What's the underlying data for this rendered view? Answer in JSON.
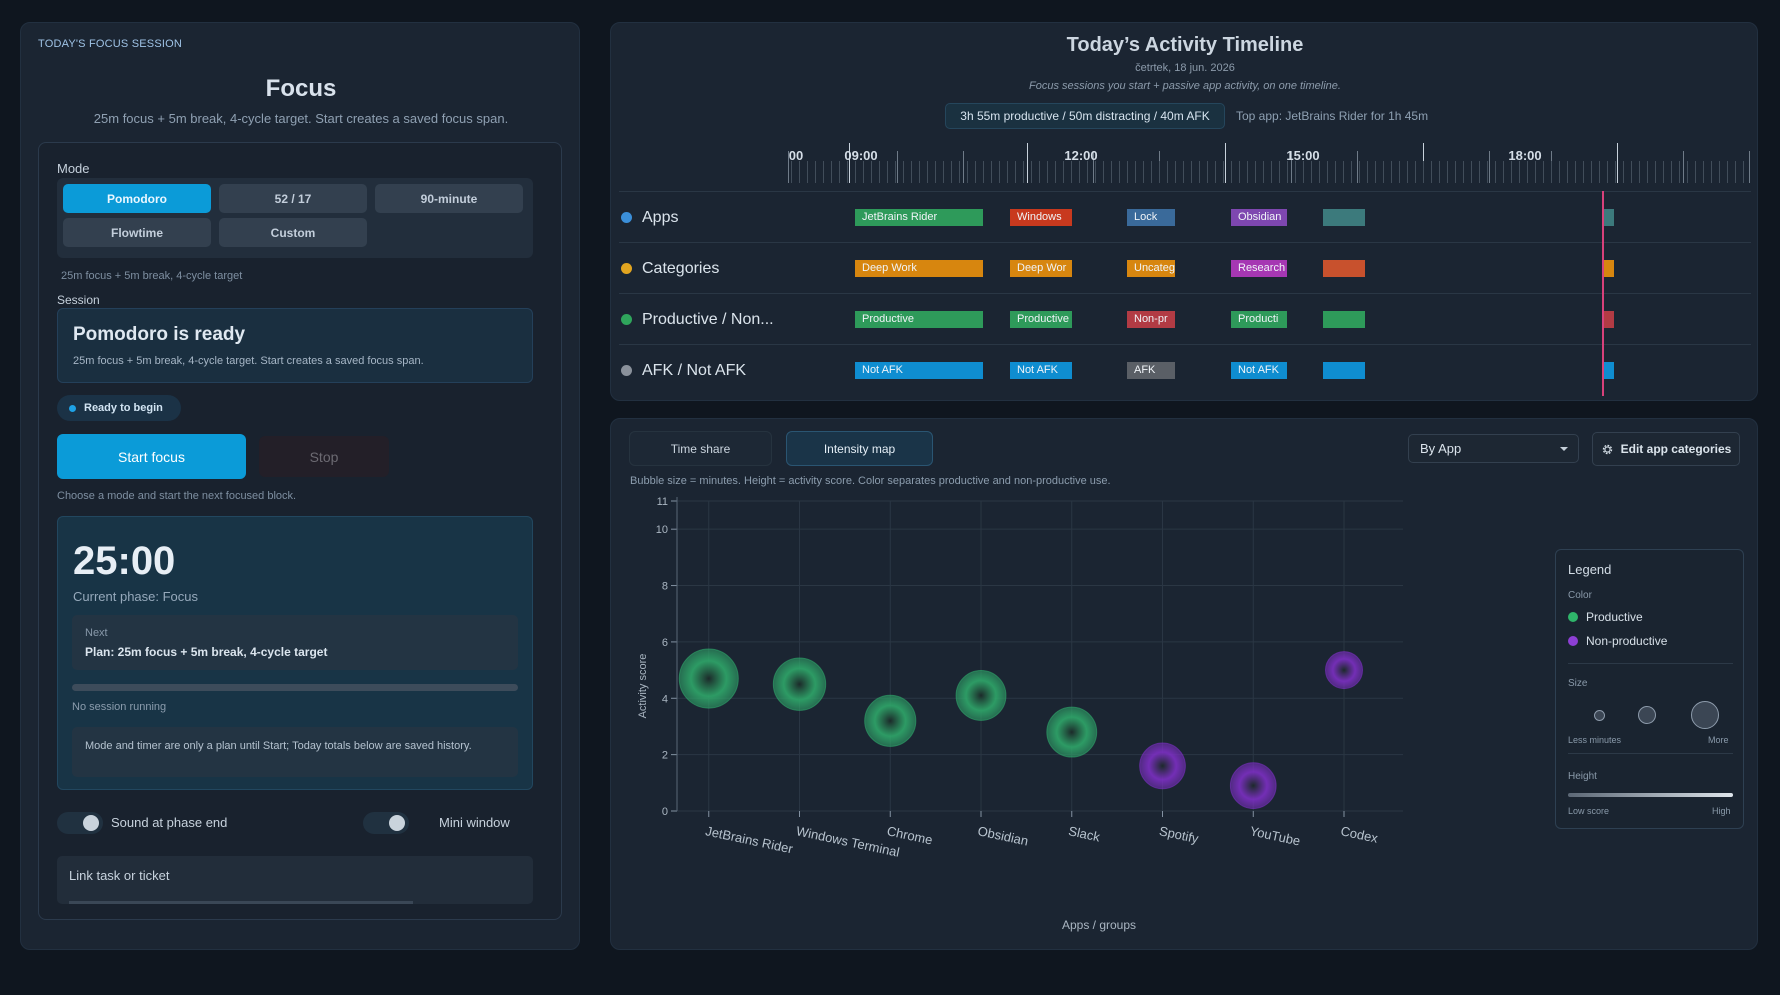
{
  "focus": {
    "eyebrow": "TODAY'S FOCUS SESSION",
    "title": "Focus",
    "subtitle": "25m focus + 5m break, 4-cycle target. Start creates a saved focus span.",
    "mode_label": "Mode",
    "modes": [
      "Pomodoro",
      "52 / 17",
      "90-minute",
      "Flowtime",
      "Custom"
    ],
    "active_mode": "Pomodoro",
    "mode_note": "25m focus + 5m break, 4-cycle target",
    "session_label": "Session",
    "session_title": "Pomodoro is ready",
    "session_desc": "25m focus + 5m break, 4-cycle target. Start creates a saved focus span.",
    "status_pill": "Ready to begin",
    "start_label": "Start focus",
    "stop_label": "Stop",
    "hint": "Choose a mode and start the next focused block.",
    "timer": "25:00",
    "phase": "Current phase: Focus",
    "next_label": "Next",
    "next_text": "Plan: 25m focus + 5m break, 4-cycle target",
    "progress": 0,
    "no_session": "No session running",
    "plan_note": "Mode and timer are only a plan until Start; Today totals below are saved history.",
    "sound_label": "Sound at phase end",
    "mini_label": "Mini window",
    "link_label": "Link task or ticket"
  },
  "timeline": {
    "title": "Today’s Activity Timeline",
    "date": "četrtek, 18 jun. 2026",
    "desc": "Focus sessions you start + passive app activity, on one timeline.",
    "summary": "3h 55m productive / 50m distracting / 40m AFK",
    "top_app": "Top app: JetBrains Rider for 1h 45m",
    "axis_labels": [
      "00",
      "09:00",
      "12:00",
      "15:00",
      "18:00"
    ],
    "rows": [
      {
        "label": "Apps",
        "dot_color": "#3b8fd9",
        "segments": [
          {
            "text": "JetBrains Rider",
            "color": "#2e9a5a"
          },
          {
            "text": "Windows",
            "color": "#c8391e"
          },
          {
            "text": "Lock",
            "color": "#3a6a9a"
          },
          {
            "text": "Obsidian",
            "color": "#7e47b0"
          },
          {
            "text": "",
            "color": "#3c7a7c"
          },
          {
            "text": "",
            "color": "#3c7a7c"
          }
        ]
      },
      {
        "label": "Categories",
        "dot_color": "#e2a520",
        "segments": [
          {
            "text": "Deep Work",
            "color": "#d7860f"
          },
          {
            "text": "Deep Wor",
            "color": "#d7860f"
          },
          {
            "text": "Uncateg",
            "color": "#d7860f"
          },
          {
            "text": "Research",
            "color": "#a637b3"
          },
          {
            "text": "",
            "color": "#c8512d"
          },
          {
            "text": "",
            "color": "#d7860f"
          }
        ]
      },
      {
        "label": "Productive / Non...",
        "dot_color": "#2fa55c",
        "segments": [
          {
            "text": "Productive",
            "color": "#2e9a5a"
          },
          {
            "text": "Productive",
            "color": "#2e9a5a"
          },
          {
            "text": "Non-pr",
            "color": "#b23b44"
          },
          {
            "text": "Producti",
            "color": "#2e9a5a"
          },
          {
            "text": "",
            "color": "#2e9a5a"
          },
          {
            "text": "",
            "color": "#b23b44"
          }
        ]
      },
      {
        "label": "AFK / Not AFK",
        "dot_color": "#8a919b",
        "segments": [
          {
            "text": "Not AFK",
            "color": "#0f8dd0"
          },
          {
            "text": "Not AFK",
            "color": "#0f8dd0"
          },
          {
            "text": "AFK",
            "color": "#5a5f66"
          },
          {
            "text": "Not AFK",
            "color": "#0f8dd0"
          },
          {
            "text": "",
            "color": "#0f8dd0"
          },
          {
            "text": "",
            "color": "#0f8dd0"
          }
        ]
      }
    ]
  },
  "intensity": {
    "tabs": [
      "Time share",
      "Intensity map"
    ],
    "active_tab": "Intensity map",
    "group_select": "By App",
    "edit_label": "Edit app categories",
    "note": "Bubble size = minutes. Height = activity score. Color separates productive and non-productive use.",
    "legend": {
      "title": "Legend",
      "color_label": "Color",
      "productive": "Productive",
      "non_productive": "Non-productive",
      "size_label": "Size",
      "less": "Less minutes",
      "more": "More",
      "height_label": "Height",
      "low": "Low score",
      "high": "High"
    }
  },
  "chart_data": {
    "type": "scatter",
    "subtype": "bubble",
    "xlabel": "Apps / groups",
    "ylabel": "Activity score",
    "ylim": [
      0,
      11
    ],
    "yticks": [
      0,
      2,
      4,
      6,
      8,
      10,
      11
    ],
    "categories": [
      "JetBrains Rider",
      "Windows Terminal",
      "Chrome",
      "Obsidian",
      "Slack",
      "Spotify",
      "YouTube",
      "Codex"
    ],
    "y": [
      4.7,
      4.5,
      3.2,
      4.1,
      2.8,
      1.6,
      0.9,
      5.0
    ],
    "size_minutes": [
      105,
      75,
      70,
      65,
      65,
      50,
      50,
      25
    ],
    "productive": [
      true,
      true,
      true,
      true,
      true,
      false,
      false,
      false
    ],
    "colors": {
      "productive": "#2fa86a",
      "non_productive": "#7d2fc4"
    },
    "grid": true
  }
}
